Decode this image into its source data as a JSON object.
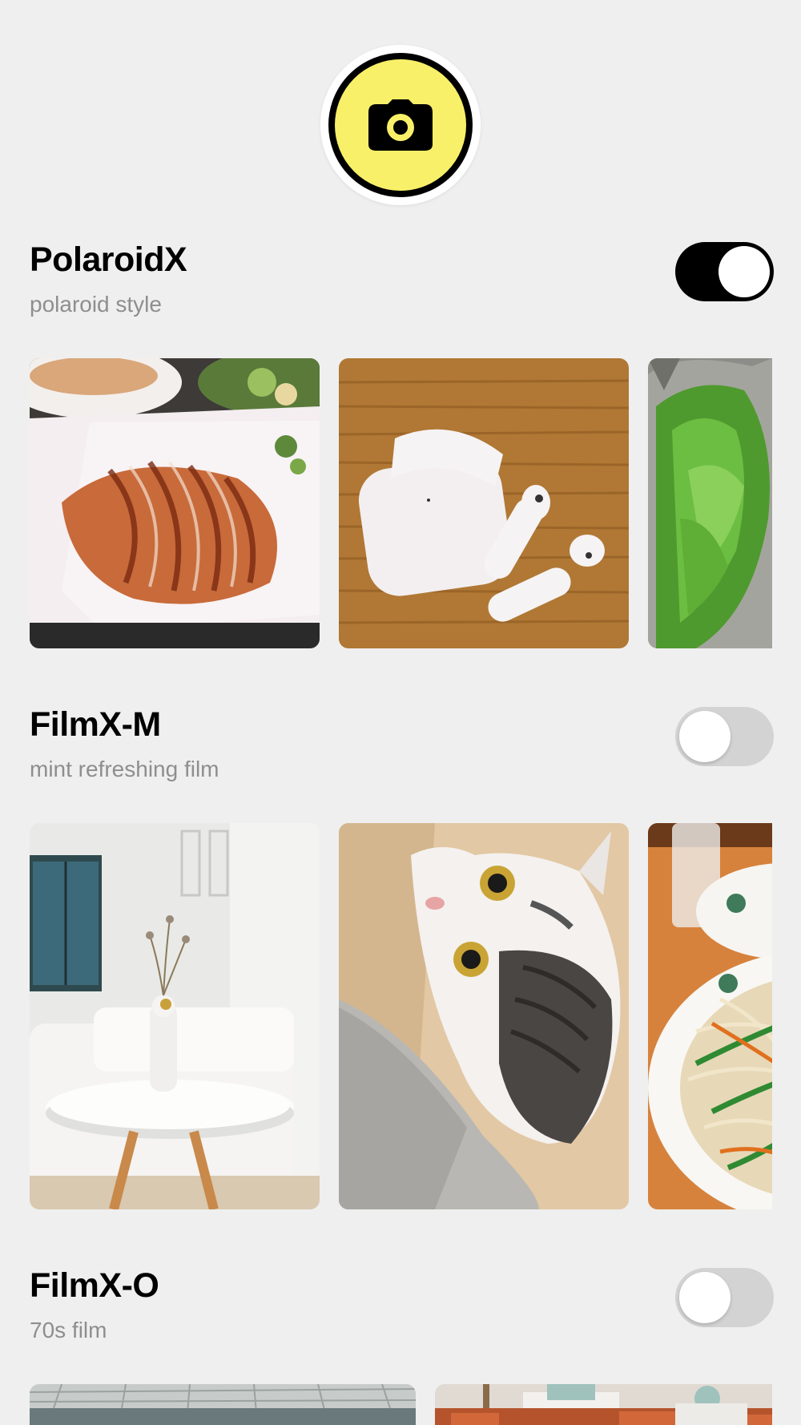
{
  "camera": {
    "icon": "camera-icon"
  },
  "sections": [
    {
      "title": "PolaroidX",
      "subtitle": "polaroid style",
      "enabled": true,
      "photos": [
        "roast-duck-photo",
        "airpods-photo",
        "lettuce-photo"
      ]
    },
    {
      "title": "FilmX-M",
      "subtitle": "mint refreshing film",
      "enabled": false,
      "photos": [
        "living-room-photo",
        "cat-photo",
        "noodles-photo"
      ]
    },
    {
      "title": "FilmX-O",
      "subtitle": "70s film",
      "enabled": false,
      "photos": [
        "stadium-photo",
        "townscape-photo"
      ]
    }
  ],
  "colors": {
    "background": "#efefef",
    "camera_yellow": "#f8f068",
    "toggle_on": "#000000",
    "toggle_off": "#d3d3d3",
    "subtitle_gray": "#8e8e8e"
  }
}
